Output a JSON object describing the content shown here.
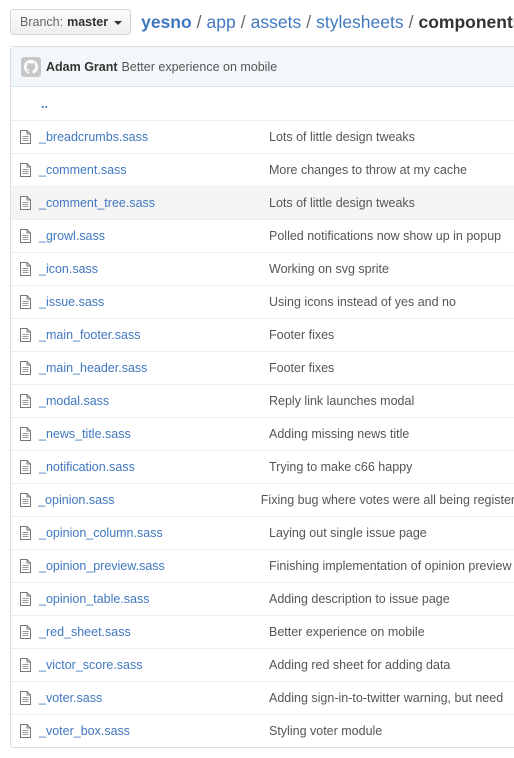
{
  "branch": {
    "label": "Branch:",
    "name": "master"
  },
  "breadcrumb": {
    "repo": "yesno",
    "parts": [
      "app",
      "assets",
      "stylesheets"
    ],
    "current": "components"
  },
  "commit": {
    "author": "Adam Grant",
    "message": "Better experience on mobile"
  },
  "up_link": "..",
  "files": [
    {
      "name": "_breadcrumbs.sass",
      "message": "Lots of little design tweaks"
    },
    {
      "name": "_comment.sass",
      "message": "More changes to throw at my cache"
    },
    {
      "name": "_comment_tree.sass",
      "message": "Lots of little design tweaks"
    },
    {
      "name": "_growl.sass",
      "message": "Polled notifications now show up in popup"
    },
    {
      "name": "_icon.sass",
      "message": "Working on svg sprite"
    },
    {
      "name": "_issue.sass",
      "message": "Using icons instead of yes and no"
    },
    {
      "name": "_main_footer.sass",
      "message": "Footer fixes"
    },
    {
      "name": "_main_header.sass",
      "message": "Footer fixes"
    },
    {
      "name": "_modal.sass",
      "message": "Reply link launches modal"
    },
    {
      "name": "_news_title.sass",
      "message": "Adding missing news title"
    },
    {
      "name": "_notification.sass",
      "message": "Trying to make c66 happy"
    },
    {
      "name": "_opinion.sass",
      "message": "Fixing bug where votes were all being registered"
    },
    {
      "name": "_opinion_column.sass",
      "message": "Laying out single issue page"
    },
    {
      "name": "_opinion_preview.sass",
      "message": "Finishing implementation of opinion preview"
    },
    {
      "name": "_opinion_table.sass",
      "message": "Adding description to issue page"
    },
    {
      "name": "_red_sheet.sass",
      "message": "Better experience on mobile"
    },
    {
      "name": "_victor_score.sass",
      "message": "Adding red sheet for adding data"
    },
    {
      "name": "_voter.sass",
      "message": "Adding sign-in-to-twitter warning, but need"
    },
    {
      "name": "_voter_box.sass",
      "message": "Styling voter module"
    }
  ]
}
